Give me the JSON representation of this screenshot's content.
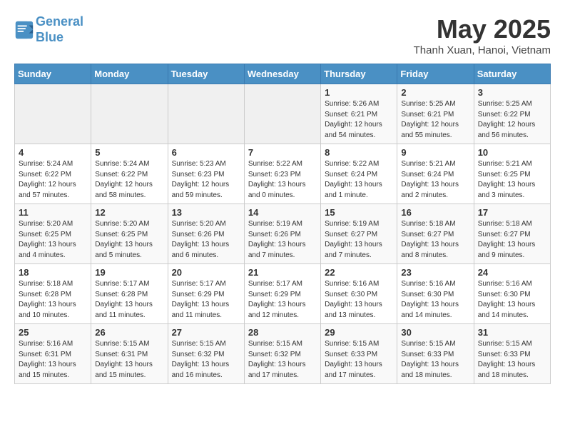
{
  "header": {
    "logo_line1": "General",
    "logo_line2": "Blue",
    "month_title": "May 2025",
    "location": "Thanh Xuan, Hanoi, Vietnam"
  },
  "days_of_week": [
    "Sunday",
    "Monday",
    "Tuesday",
    "Wednesday",
    "Thursday",
    "Friday",
    "Saturday"
  ],
  "weeks": [
    [
      {
        "day": "",
        "info": ""
      },
      {
        "day": "",
        "info": ""
      },
      {
        "day": "",
        "info": ""
      },
      {
        "day": "",
        "info": ""
      },
      {
        "day": "1",
        "info": "Sunrise: 5:26 AM\nSunset: 6:21 PM\nDaylight: 12 hours\nand 54 minutes."
      },
      {
        "day": "2",
        "info": "Sunrise: 5:25 AM\nSunset: 6:21 PM\nDaylight: 12 hours\nand 55 minutes."
      },
      {
        "day": "3",
        "info": "Sunrise: 5:25 AM\nSunset: 6:22 PM\nDaylight: 12 hours\nand 56 minutes."
      }
    ],
    [
      {
        "day": "4",
        "info": "Sunrise: 5:24 AM\nSunset: 6:22 PM\nDaylight: 12 hours\nand 57 minutes."
      },
      {
        "day": "5",
        "info": "Sunrise: 5:24 AM\nSunset: 6:22 PM\nDaylight: 12 hours\nand 58 minutes."
      },
      {
        "day": "6",
        "info": "Sunrise: 5:23 AM\nSunset: 6:23 PM\nDaylight: 12 hours\nand 59 minutes."
      },
      {
        "day": "7",
        "info": "Sunrise: 5:22 AM\nSunset: 6:23 PM\nDaylight: 13 hours\nand 0 minutes."
      },
      {
        "day": "8",
        "info": "Sunrise: 5:22 AM\nSunset: 6:24 PM\nDaylight: 13 hours\nand 1 minute."
      },
      {
        "day": "9",
        "info": "Sunrise: 5:21 AM\nSunset: 6:24 PM\nDaylight: 13 hours\nand 2 minutes."
      },
      {
        "day": "10",
        "info": "Sunrise: 5:21 AM\nSunset: 6:25 PM\nDaylight: 13 hours\nand 3 minutes."
      }
    ],
    [
      {
        "day": "11",
        "info": "Sunrise: 5:20 AM\nSunset: 6:25 PM\nDaylight: 13 hours\nand 4 minutes."
      },
      {
        "day": "12",
        "info": "Sunrise: 5:20 AM\nSunset: 6:25 PM\nDaylight: 13 hours\nand 5 minutes."
      },
      {
        "day": "13",
        "info": "Sunrise: 5:20 AM\nSunset: 6:26 PM\nDaylight: 13 hours\nand 6 minutes."
      },
      {
        "day": "14",
        "info": "Sunrise: 5:19 AM\nSunset: 6:26 PM\nDaylight: 13 hours\nand 7 minutes."
      },
      {
        "day": "15",
        "info": "Sunrise: 5:19 AM\nSunset: 6:27 PM\nDaylight: 13 hours\nand 7 minutes."
      },
      {
        "day": "16",
        "info": "Sunrise: 5:18 AM\nSunset: 6:27 PM\nDaylight: 13 hours\nand 8 minutes."
      },
      {
        "day": "17",
        "info": "Sunrise: 5:18 AM\nSunset: 6:27 PM\nDaylight: 13 hours\nand 9 minutes."
      }
    ],
    [
      {
        "day": "18",
        "info": "Sunrise: 5:18 AM\nSunset: 6:28 PM\nDaylight: 13 hours\nand 10 minutes."
      },
      {
        "day": "19",
        "info": "Sunrise: 5:17 AM\nSunset: 6:28 PM\nDaylight: 13 hours\nand 11 minutes."
      },
      {
        "day": "20",
        "info": "Sunrise: 5:17 AM\nSunset: 6:29 PM\nDaylight: 13 hours\nand 11 minutes."
      },
      {
        "day": "21",
        "info": "Sunrise: 5:17 AM\nSunset: 6:29 PM\nDaylight: 13 hours\nand 12 minutes."
      },
      {
        "day": "22",
        "info": "Sunrise: 5:16 AM\nSunset: 6:30 PM\nDaylight: 13 hours\nand 13 minutes."
      },
      {
        "day": "23",
        "info": "Sunrise: 5:16 AM\nSunset: 6:30 PM\nDaylight: 13 hours\nand 14 minutes."
      },
      {
        "day": "24",
        "info": "Sunrise: 5:16 AM\nSunset: 6:30 PM\nDaylight: 13 hours\nand 14 minutes."
      }
    ],
    [
      {
        "day": "25",
        "info": "Sunrise: 5:16 AM\nSunset: 6:31 PM\nDaylight: 13 hours\nand 15 minutes."
      },
      {
        "day": "26",
        "info": "Sunrise: 5:15 AM\nSunset: 6:31 PM\nDaylight: 13 hours\nand 15 minutes."
      },
      {
        "day": "27",
        "info": "Sunrise: 5:15 AM\nSunset: 6:32 PM\nDaylight: 13 hours\nand 16 minutes."
      },
      {
        "day": "28",
        "info": "Sunrise: 5:15 AM\nSunset: 6:32 PM\nDaylight: 13 hours\nand 17 minutes."
      },
      {
        "day": "29",
        "info": "Sunrise: 5:15 AM\nSunset: 6:33 PM\nDaylight: 13 hours\nand 17 minutes."
      },
      {
        "day": "30",
        "info": "Sunrise: 5:15 AM\nSunset: 6:33 PM\nDaylight: 13 hours\nand 18 minutes."
      },
      {
        "day": "31",
        "info": "Sunrise: 5:15 AM\nSunset: 6:33 PM\nDaylight: 13 hours\nand 18 minutes."
      }
    ]
  ]
}
